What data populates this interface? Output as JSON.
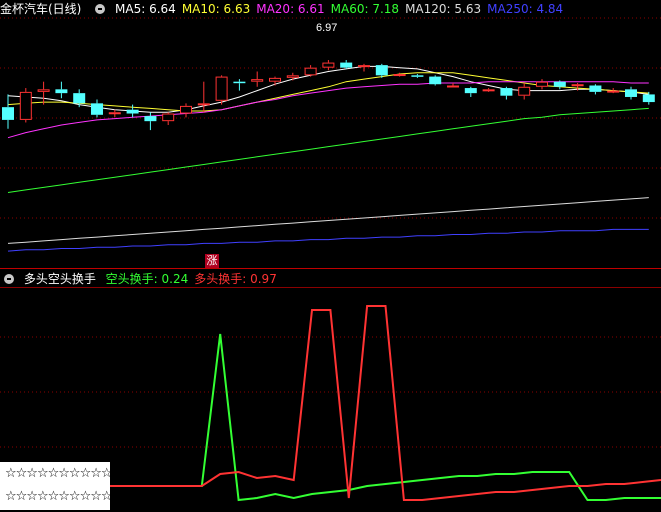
{
  "top_header": {
    "title": "金杯汽车(日线)",
    "ma_items": [
      {
        "label": "MA5: 6.64",
        "color": "#ffffff"
      },
      {
        "label": "MA10: 6.63",
        "color": "#ffff33"
      },
      {
        "label": "MA20: 6.61",
        "color": "#ff33ff"
      },
      {
        "label": "MA60: 7.18",
        "color": "#33ff33"
      },
      {
        "label": "MA120: 5.63",
        "color": "#dcdcdc"
      },
      {
        "label": "MA250: 4.84",
        "color": "#4040ff"
      }
    ]
  },
  "high_marker": "6.97",
  "zhang_badge": "涨",
  "bottom_header": {
    "title": "多头空头换手",
    "items": [
      {
        "label": "空头换手: 0.24",
        "color": "#33ff33"
      },
      {
        "label": "多头换手: 0.97",
        "color": "#ff3333"
      }
    ]
  },
  "stars": {
    "row1": "☆☆☆☆☆☆☆☆☆☆☆",
    "row2": "☆☆☆☆☆☆☆☆☆☆☆"
  },
  "colors": {
    "up": "#ff3333",
    "down": "#54ffff",
    "grid": "#8b0000",
    "divider": "#c00000"
  },
  "chart_data": [
    {
      "type": "candlestick",
      "title": "金杯汽车(日线)",
      "ylim": [
        5.4,
        7.3
      ],
      "candles": [
        {
          "o": 6.6,
          "h": 6.7,
          "l": 6.43,
          "c": 6.5
        },
        {
          "o": 6.5,
          "h": 6.75,
          "l": 6.48,
          "c": 6.72
        },
        {
          "o": 6.72,
          "h": 6.8,
          "l": 6.62,
          "c": 6.74
        },
        {
          "o": 6.74,
          "h": 6.8,
          "l": 6.67,
          "c": 6.71
        },
        {
          "o": 6.71,
          "h": 6.74,
          "l": 6.6,
          "c": 6.63
        },
        {
          "o": 6.63,
          "h": 6.66,
          "l": 6.52,
          "c": 6.54
        },
        {
          "o": 6.55,
          "h": 6.58,
          "l": 6.52,
          "c": 6.56
        },
        {
          "o": 6.58,
          "h": 6.62,
          "l": 6.52,
          "c": 6.55
        },
        {
          "o": 6.53,
          "h": 6.56,
          "l": 6.42,
          "c": 6.49
        },
        {
          "o": 6.49,
          "h": 6.56,
          "l": 6.46,
          "c": 6.55
        },
        {
          "o": 6.55,
          "h": 6.63,
          "l": 6.52,
          "c": 6.61
        },
        {
          "o": 6.62,
          "h": 6.8,
          "l": 6.56,
          "c": 6.63
        },
        {
          "o": 6.65,
          "h": 6.85,
          "l": 6.62,
          "c": 6.84
        },
        {
          "o": 6.8,
          "h": 6.82,
          "l": 6.73,
          "c": 6.79
        },
        {
          "o": 6.8,
          "h": 6.88,
          "l": 6.76,
          "c": 6.82
        },
        {
          "o": 6.8,
          "h": 6.84,
          "l": 6.77,
          "c": 6.83
        },
        {
          "o": 6.83,
          "h": 6.87,
          "l": 6.81,
          "c": 6.85
        },
        {
          "o": 6.85,
          "h": 6.93,
          "l": 6.84,
          "c": 6.91
        },
        {
          "o": 6.91,
          "h": 6.97,
          "l": 6.89,
          "c": 6.95
        },
        {
          "o": 6.95,
          "h": 6.97,
          "l": 6.9,
          "c": 6.91
        },
        {
          "o": 6.92,
          "h": 6.94,
          "l": 6.88,
          "c": 6.93
        },
        {
          "o": 6.93,
          "h": 6.94,
          "l": 6.83,
          "c": 6.85
        },
        {
          "o": 6.85,
          "h": 6.87,
          "l": 6.84,
          "c": 6.86
        },
        {
          "o": 6.85,
          "h": 6.86,
          "l": 6.83,
          "c": 6.84
        },
        {
          "o": 6.84,
          "h": 6.85,
          "l": 6.77,
          "c": 6.78
        },
        {
          "o": 6.77,
          "h": 6.79,
          "l": 6.76,
          "c": 6.77
        },
        {
          "o": 6.75,
          "h": 6.76,
          "l": 6.68,
          "c": 6.71
        },
        {
          "o": 6.73,
          "h": 6.75,
          "l": 6.72,
          "c": 6.74
        },
        {
          "o": 6.75,
          "h": 6.76,
          "l": 6.66,
          "c": 6.69
        },
        {
          "o": 6.69,
          "h": 6.79,
          "l": 6.66,
          "c": 6.76
        },
        {
          "o": 6.76,
          "h": 6.82,
          "l": 6.74,
          "c": 6.8
        },
        {
          "o": 6.8,
          "h": 6.81,
          "l": 6.74,
          "c": 6.76
        },
        {
          "o": 6.77,
          "h": 6.79,
          "l": 6.73,
          "c": 6.78
        },
        {
          "o": 6.77,
          "h": 6.78,
          "l": 6.7,
          "c": 6.72
        },
        {
          "o": 6.72,
          "h": 6.75,
          "l": 6.71,
          "c": 6.73
        },
        {
          "o": 6.74,
          "h": 6.76,
          "l": 6.66,
          "c": 6.68
        },
        {
          "o": 6.7,
          "h": 6.72,
          "l": 6.62,
          "c": 6.64
        }
      ],
      "ma": {
        "MA5": [
          6.69,
          6.68,
          6.67,
          6.65,
          6.62,
          6.6,
          6.58,
          6.57,
          6.56,
          6.56,
          6.58,
          6.61,
          6.64,
          6.68,
          6.73,
          6.78,
          6.82,
          6.85,
          6.88,
          6.9,
          6.92,
          6.92,
          6.91,
          6.9,
          6.87,
          6.84,
          6.8,
          6.77,
          6.74,
          6.73,
          6.73,
          6.73,
          6.74,
          6.74,
          6.73,
          6.72,
          6.7
        ],
        "MA10": [
          6.62,
          6.63,
          6.64,
          6.64,
          6.63,
          6.62,
          6.61,
          6.6,
          6.59,
          6.58,
          6.57,
          6.57,
          6.58,
          6.61,
          6.64,
          6.67,
          6.7,
          6.73,
          6.76,
          6.8,
          6.82,
          6.84,
          6.86,
          6.87,
          6.87,
          6.87,
          6.85,
          6.83,
          6.81,
          6.79,
          6.77,
          6.76,
          6.75,
          6.74,
          6.73,
          6.72,
          6.71
        ],
        "MA20": [
          6.36,
          6.4,
          6.43,
          6.46,
          6.48,
          6.5,
          6.51,
          6.52,
          6.53,
          6.54,
          6.55,
          6.56,
          6.58,
          6.61,
          6.64,
          6.66,
          6.69,
          6.71,
          6.73,
          6.75,
          6.76,
          6.77,
          6.78,
          6.78,
          6.79,
          6.79,
          6.79,
          6.8,
          6.8,
          6.8,
          6.8,
          6.8,
          6.8,
          6.8,
          6.8,
          6.79,
          6.79
        ],
        "MA60": [
          5.93,
          5.95,
          5.97,
          5.99,
          6.01,
          6.03,
          6.05,
          6.07,
          6.09,
          6.11,
          6.13,
          6.15,
          6.17,
          6.19,
          6.21,
          6.23,
          6.25,
          6.27,
          6.29,
          6.31,
          6.33,
          6.35,
          6.37,
          6.39,
          6.41,
          6.43,
          6.45,
          6.47,
          6.49,
          6.51,
          6.52,
          6.54,
          6.55,
          6.56,
          6.57,
          6.58,
          6.59
        ],
        "MA120": [
          5.53,
          5.54,
          5.55,
          5.56,
          5.57,
          5.58,
          5.59,
          5.6,
          5.61,
          5.62,
          5.63,
          5.64,
          5.65,
          5.66,
          5.67,
          5.68,
          5.69,
          5.7,
          5.71,
          5.72,
          5.73,
          5.74,
          5.75,
          5.76,
          5.77,
          5.78,
          5.79,
          5.8,
          5.81,
          5.82,
          5.83,
          5.84,
          5.85,
          5.86,
          5.87,
          5.88,
          5.89
        ],
        "MA250": [
          5.47,
          5.48,
          5.48,
          5.49,
          5.49,
          5.5,
          5.5,
          5.51,
          5.51,
          5.52,
          5.52,
          5.53,
          5.53,
          5.54,
          5.54,
          5.55,
          5.55,
          5.56,
          5.56,
          5.57,
          5.57,
          5.58,
          5.58,
          5.59,
          5.59,
          5.6,
          5.6,
          5.61,
          5.61,
          5.62,
          5.62,
          5.63,
          5.63,
          5.63,
          5.64,
          5.64,
          5.64
        ]
      }
    },
    {
      "type": "line",
      "title": "多头空头换手",
      "ylim": [
        0,
        1.05
      ],
      "x": [
        0,
        1,
        2,
        3,
        4,
        5,
        6,
        7,
        8,
        9,
        10,
        11,
        12,
        13,
        14,
        15,
        16,
        17,
        18,
        19,
        20,
        21,
        22,
        23,
        24,
        25,
        26,
        27,
        28,
        29,
        30
      ],
      "series": [
        {
          "name": "空头换手",
          "color": "#33ff33",
          "values": [
            0.12,
            0.12,
            0.12,
            0.12,
            0.12,
            0.12,
            0.88,
            0.05,
            0.06,
            0.08,
            0.06,
            0.08,
            0.09,
            0.1,
            0.12,
            0.13,
            0.14,
            0.15,
            0.16,
            0.17,
            0.17,
            0.18,
            0.18,
            0.19,
            0.19,
            0.19,
            0.05,
            0.05,
            0.06,
            0.06,
            0.06
          ]
        },
        {
          "name": "多头换手",
          "color": "#ff3333",
          "values": [
            0.12,
            0.12,
            0.12,
            0.12,
            0.12,
            0.12,
            0.18,
            0.19,
            0.16,
            0.17,
            0.15,
            1.0,
            1.0,
            0.06,
            1.02,
            1.02,
            0.05,
            0.05,
            0.06,
            0.07,
            0.08,
            0.09,
            0.09,
            0.1,
            0.11,
            0.12,
            0.12,
            0.13,
            0.13,
            0.14,
            0.15
          ]
        }
      ]
    }
  ]
}
